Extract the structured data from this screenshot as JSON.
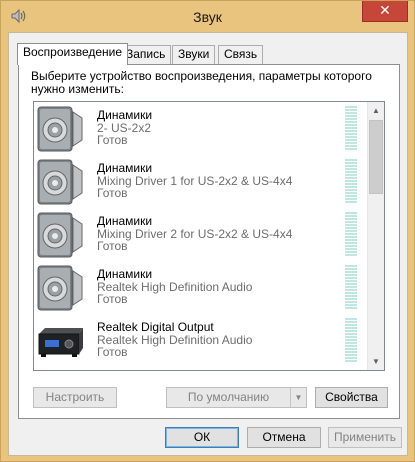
{
  "window": {
    "title": "Звук",
    "close_label": "✕"
  },
  "tabs": [
    {
      "label": "Воспроизведение",
      "active": true
    },
    {
      "label": "Запись",
      "active": false
    },
    {
      "label": "Звуки",
      "active": false
    },
    {
      "label": "Связь",
      "active": false
    }
  ],
  "instruction": "Выберите устройство воспроизведения, параметры которого нужно изменить:",
  "devices": [
    {
      "name": "Динамики",
      "description": "2- US-2x2",
      "status": "Готов",
      "icon": "speaker-icon"
    },
    {
      "name": "Динамики",
      "description": "Mixing Driver 1 for US-2x2 & US-4x4",
      "status": "Готов",
      "icon": "speaker-icon"
    },
    {
      "name": "Динамики",
      "description": "Mixing Driver 2 for US-2x2 & US-4x4",
      "status": "Готов",
      "icon": "speaker-icon"
    },
    {
      "name": "Динамики",
      "description": "Realtek High Definition Audio",
      "status": "Готов",
      "icon": "speaker-icon"
    },
    {
      "name": "Realtek Digital Output",
      "description": "Realtek High Definition Audio",
      "status": "Готов",
      "icon": "digital-receiver-icon"
    }
  ],
  "buttons": {
    "configure": "Настроить",
    "set_default": "По умолчанию",
    "properties": "Свойства",
    "ok": "ОК",
    "cancel": "Отмена",
    "apply": "Применить"
  },
  "colors": {
    "frame": "#e9c47e",
    "close": "#c7463a",
    "meter": "#bfe6e0"
  }
}
